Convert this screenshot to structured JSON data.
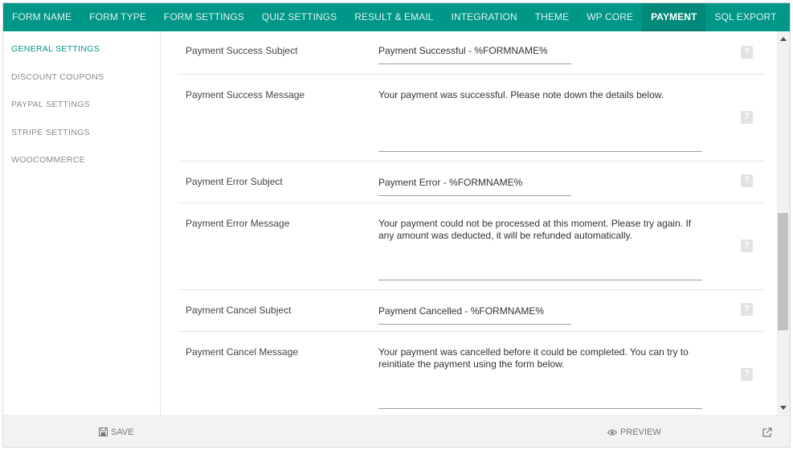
{
  "nav": {
    "tabs": [
      {
        "label": "FORM NAME"
      },
      {
        "label": "FORM TYPE"
      },
      {
        "label": "FORM SETTINGS"
      },
      {
        "label": "QUIZ SETTINGS"
      },
      {
        "label": "RESULT & EMAIL"
      },
      {
        "label": "INTEGRATION"
      },
      {
        "label": "THEME"
      },
      {
        "label": "WP CORE"
      },
      {
        "label": "PAYMENT"
      },
      {
        "label": "SQL EXPORT"
      }
    ],
    "active_tab": "PAYMENT"
  },
  "sidebar": {
    "items": [
      {
        "label": "GENERAL SETTINGS"
      },
      {
        "label": "DISCOUNT COUPONS"
      },
      {
        "label": "PAYPAL SETTINGS"
      },
      {
        "label": "STRIPE SETTINGS"
      },
      {
        "label": "WOOCOMMERCE"
      }
    ],
    "active_item": "GENERAL SETTINGS"
  },
  "settings": {
    "rows": [
      {
        "label": "Payment Success Subject",
        "value": "Payment Successful - %FORMNAME%"
      },
      {
        "label": "Payment Success Message",
        "value": "Your payment was successful. Please note down the details below."
      },
      {
        "label": "Payment Error Subject",
        "value": "Payment Error - %FORMNAME%"
      },
      {
        "label": "Payment Error Message",
        "value": "Your payment could not be processed at this moment. Please try again. If any amount was deducted, it will be refunded automatically."
      },
      {
        "label": "Payment Cancel Subject",
        "value": "Payment Cancelled - %FORMNAME%"
      },
      {
        "label": "Payment Cancel Message",
        "value": "Your payment was cancelled before it could be completed. You can try to reinitiate the payment using the form below."
      }
    ],
    "help_icon": "question-icon"
  },
  "footer": {
    "save_label": "SAVE",
    "preview_label": "PREVIEW",
    "external_icon": "external-link-icon"
  },
  "colors": {
    "accent": "#009688",
    "active_tab_bg": "#00897b"
  }
}
